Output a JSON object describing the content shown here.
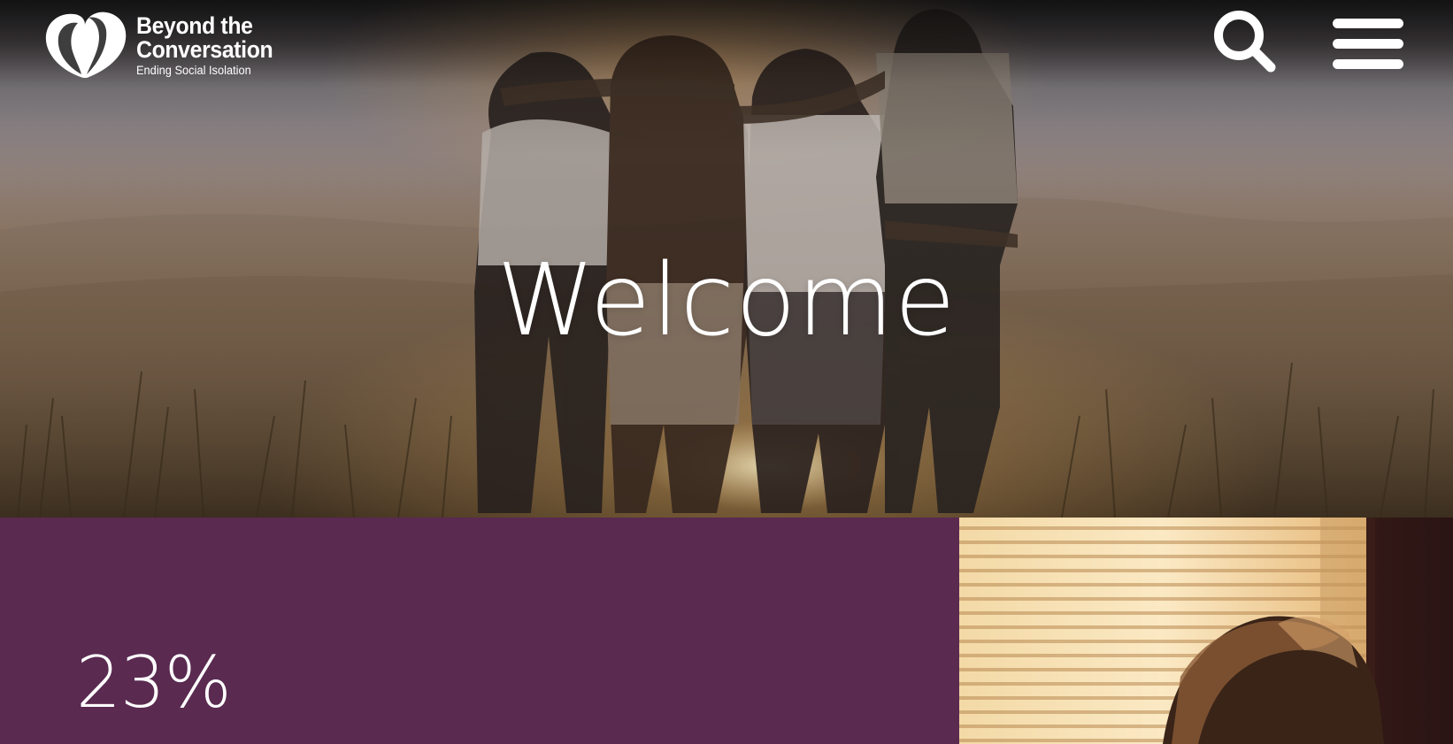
{
  "header": {
    "logo": {
      "title_line_1": "Beyond the",
      "title_line_2": "Conversation",
      "tagline": "Ending Social Isolation"
    },
    "search_icon": "search-icon",
    "menu_icon": "hamburger-menu-icon"
  },
  "hero": {
    "heading": "Welcome"
  },
  "stats": {
    "percentage": "23%"
  },
  "colors": {
    "brand_purple": "#5a2a50",
    "text_white": "#ffffff"
  }
}
